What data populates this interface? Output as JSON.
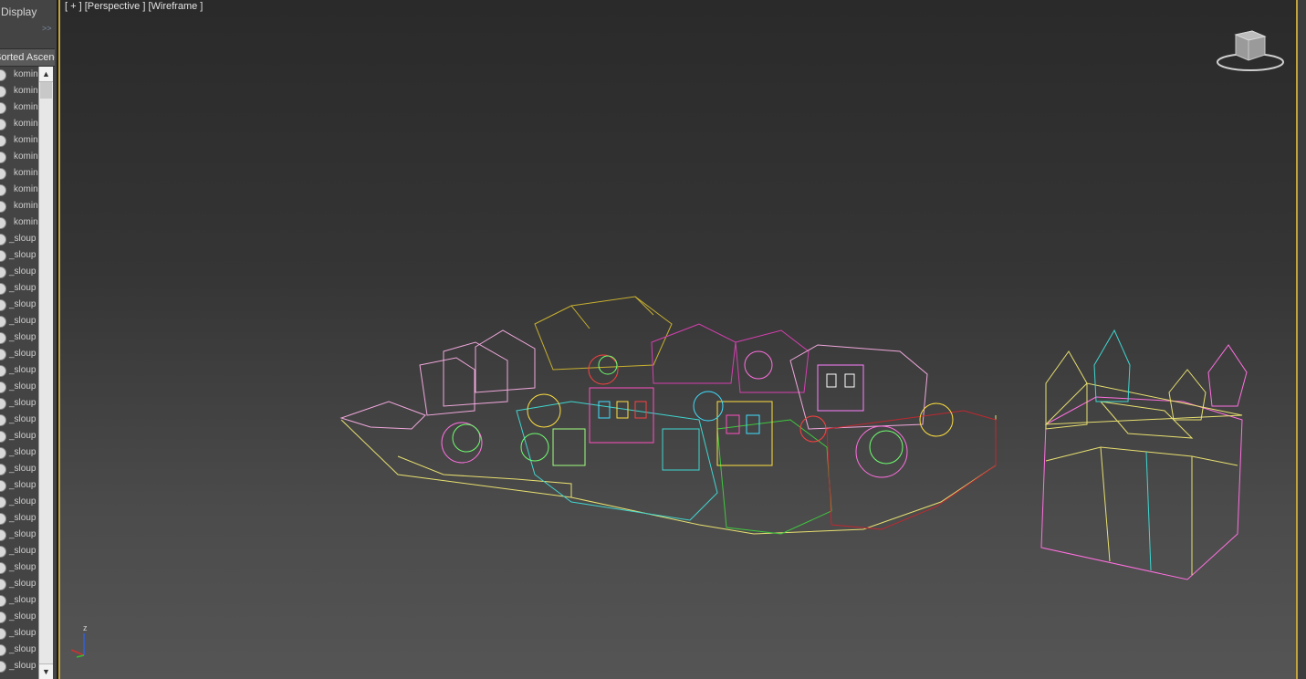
{
  "left_panel": {
    "title": "Display",
    "expand_glyph": ">>",
    "sort_header": "Sorted Ascending",
    "scroll_up_glyph": "▲",
    "scroll_down_glyph": "▼",
    "objects": [
      "komin",
      "komin",
      "komin",
      "komin",
      "komin",
      "komin",
      "komin",
      "komin",
      "komin",
      "komin",
      "_sloup",
      "_sloup",
      "_sloup",
      "_sloup",
      "_sloup",
      "_sloup",
      "_sloup",
      "_sloup",
      "_sloup",
      "_sloup",
      "_sloup",
      "_sloup",
      "_sloup",
      "_sloup",
      "_sloup",
      "_sloup",
      "_sloup",
      "_sloup",
      "_sloup",
      "_sloup",
      "_sloup",
      "_sloup",
      "_sloup",
      "_sloup",
      "_sloup",
      "_sloup",
      "_sloup"
    ]
  },
  "viewport": {
    "menu_plus": "+",
    "view_mode": "Perspective",
    "shading_mode": "Wireframe",
    "axis_label": "z",
    "icons": [
      "viewcube-icon",
      "axis-tripod-icon"
    ]
  },
  "colors": {
    "viewport_border": "#c2a23c",
    "wire_pink": "#f0a8dc",
    "wire_magenta": "#d63fb0",
    "wire_yellow": "#e8e070",
    "wire_cyan": "#3fd6d0",
    "wire_green": "#3fc83f",
    "wire_red": "#c02830"
  }
}
